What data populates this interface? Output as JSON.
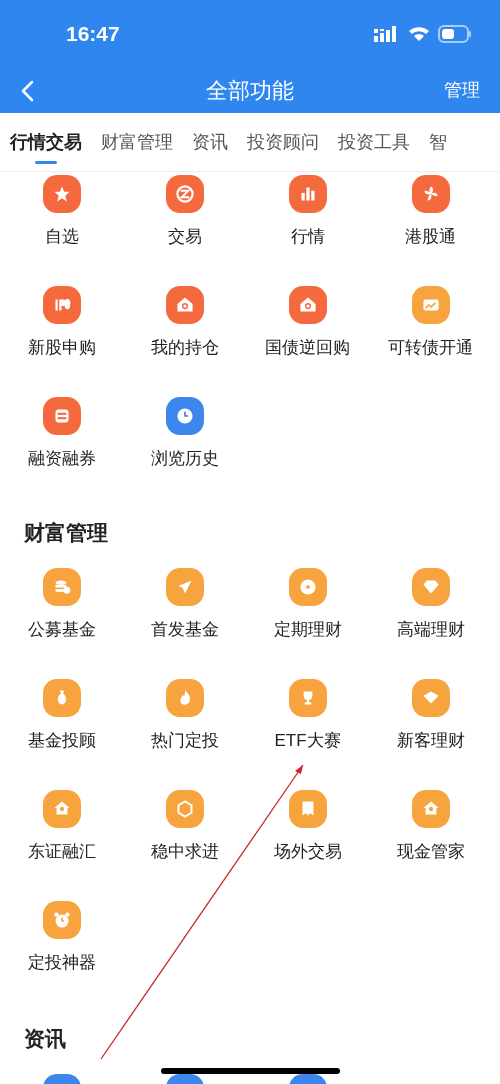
{
  "status_bar": {
    "time": "16:47"
  },
  "nav": {
    "title": "全部功能",
    "action": "管理"
  },
  "tabs": [
    {
      "label": "行情交易",
      "selected": true
    },
    {
      "label": "财富管理",
      "selected": false
    },
    {
      "label": "资讯",
      "selected": false
    },
    {
      "label": "投资顾问",
      "selected": false
    },
    {
      "label": "投资工具",
      "selected": false
    },
    {
      "label": "智",
      "selected": false
    }
  ],
  "sections": [
    {
      "items": [
        {
          "label": "自选",
          "color": "#f5693f"
        },
        {
          "label": "交易",
          "color": "#f5693f"
        },
        {
          "label": "行情",
          "color": "#f5693f"
        },
        {
          "label": "港股通",
          "color": "#f5693f"
        },
        {
          "label": "新股申购",
          "color": "#f5693f"
        },
        {
          "label": "我的持仓",
          "color": "#f5693f"
        },
        {
          "label": "国债逆回购",
          "color": "#f5693f"
        },
        {
          "label": "可转债开通",
          "color": "#f7a33e"
        },
        {
          "label": "融资融券",
          "color": "#f5693f"
        },
        {
          "label": "浏览历史",
          "color": "#3d86ee"
        }
      ]
    },
    {
      "title": "财富管理",
      "items": [
        {
          "label": "公募基金",
          "color": "#f7a33e"
        },
        {
          "label": "首发基金",
          "color": "#f7a33e"
        },
        {
          "label": "定期理财",
          "color": "#f7a33e"
        },
        {
          "label": "高端理财",
          "color": "#f7a33e"
        },
        {
          "label": "基金投顾",
          "color": "#f7a33e"
        },
        {
          "label": "热门定投",
          "color": "#f7a33e"
        },
        {
          "label": "ETF大赛",
          "color": "#f7a33e"
        },
        {
          "label": "新客理财",
          "color": "#f7a33e"
        },
        {
          "label": "东证融汇",
          "color": "#f7a33e"
        },
        {
          "label": "稳中求进",
          "color": "#f7a33e"
        },
        {
          "label": "场外交易",
          "color": "#f7a33e"
        },
        {
          "label": "现金管家",
          "color": "#f7a33e"
        },
        {
          "label": "定投神器",
          "color": "#f7a33e"
        }
      ]
    },
    {
      "title": "资讯",
      "items": [
        {
          "color": "#3d86ee"
        },
        {
          "color": "#3d86ee"
        },
        {
          "color": "#3d86ee"
        }
      ]
    }
  ]
}
